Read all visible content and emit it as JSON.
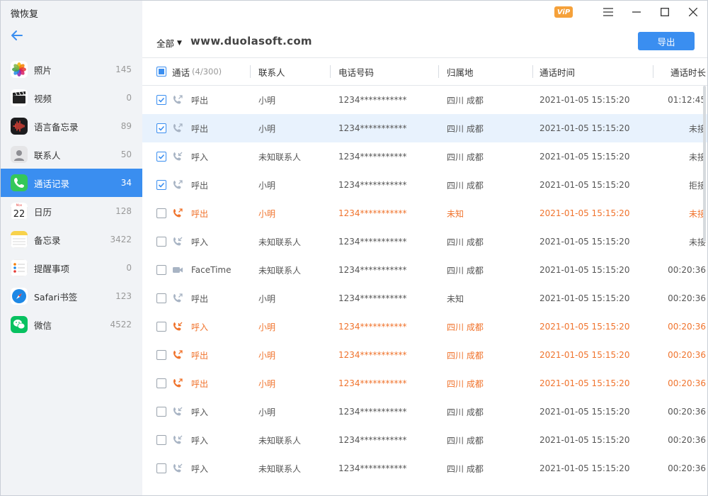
{
  "app": {
    "title": "微恢复",
    "vip_label": "ViP"
  },
  "sidebar": {
    "items": [
      {
        "label": "照片",
        "count": "145",
        "icon": "photos-icon"
      },
      {
        "label": "视频",
        "count": "0",
        "icon": "video-icon"
      },
      {
        "label": "语言备忘录",
        "count": "89",
        "icon": "voice-memo-icon"
      },
      {
        "label": "联系人",
        "count": "50",
        "icon": "contacts-icon"
      },
      {
        "label": "通话记录",
        "count": "34",
        "icon": "phone-icon",
        "active": true
      },
      {
        "label": "日历",
        "count": "128",
        "icon": "calendar-icon",
        "calendar_day": "22"
      },
      {
        "label": "备忘录",
        "count": "3422",
        "icon": "notes-icon"
      },
      {
        "label": "提醒事项",
        "count": "0",
        "icon": "reminders-icon"
      },
      {
        "label": "Safari书签",
        "count": "123",
        "icon": "safari-icon"
      },
      {
        "label": "微信",
        "count": "4522",
        "icon": "wechat-icon"
      }
    ]
  },
  "toolbar": {
    "filter_label": "全部",
    "watermark": "www.duolasoft.com",
    "export_label": "导出"
  },
  "table": {
    "headers": {
      "type": "通话",
      "type_count": "(4/300)",
      "contact": "联系人",
      "phone": "电话号码",
      "location": "归属地",
      "time": "通话时间",
      "duration": "通话时长"
    },
    "rows": [
      {
        "checked": true,
        "kind": "out",
        "type": "呼出",
        "contact": "小明",
        "phone": "1234***********",
        "location": "四川 成都",
        "time": "2021-01-05 15:15:20",
        "duration": "01:12:45",
        "missed": false,
        "selected": false
      },
      {
        "checked": true,
        "kind": "out",
        "type": "呼出",
        "contact": "小明",
        "phone": "1234***********",
        "location": "四川 成都",
        "time": "2021-01-05 15:15:20",
        "duration": "未接",
        "missed": false,
        "selected": true
      },
      {
        "checked": true,
        "kind": "in",
        "type": "呼入",
        "contact": "未知联系人",
        "phone": "1234***********",
        "location": "四川 成都",
        "time": "2021-01-05 15:15:20",
        "duration": "未接",
        "missed": false,
        "selected": false
      },
      {
        "checked": true,
        "kind": "out",
        "type": "呼出",
        "contact": "小明",
        "phone": "1234***********",
        "location": "四川 成都",
        "time": "2021-01-05 15:15:20",
        "duration": "拒接",
        "missed": false,
        "selected": false
      },
      {
        "checked": false,
        "kind": "out",
        "type": "呼出",
        "contact": "小明",
        "phone": "1234***********",
        "location": "未知",
        "time": "2021-01-05 15:15:20",
        "duration": "未接",
        "missed": true,
        "selected": false
      },
      {
        "checked": false,
        "kind": "in",
        "type": "呼入",
        "contact": "未知联系人",
        "phone": "1234***********",
        "location": "四川 成都",
        "time": "2021-01-05 15:15:20",
        "duration": "未接",
        "missed": false,
        "selected": false
      },
      {
        "checked": false,
        "kind": "facetime",
        "type": "FaceTime",
        "contact": "未知联系人",
        "phone": "1234***********",
        "location": "四川 成都",
        "time": "2021-01-05 15:15:20",
        "duration": "00:20:36",
        "missed": false,
        "selected": false
      },
      {
        "checked": false,
        "kind": "out",
        "type": "呼出",
        "contact": "小明",
        "phone": "1234***********",
        "location": "未知",
        "time": "2021-01-05 15:15:20",
        "duration": "00:20:36",
        "missed": false,
        "selected": false
      },
      {
        "checked": false,
        "kind": "in",
        "type": "呼入",
        "contact": "小明",
        "phone": "1234***********",
        "location": "四川 成都",
        "time": "2021-01-05 15:15:20",
        "duration": "00:20:36",
        "missed": true,
        "selected": false
      },
      {
        "checked": false,
        "kind": "out",
        "type": "呼出",
        "contact": "小明",
        "phone": "1234***********",
        "location": "四川 成都",
        "time": "2021-01-05 15:15:20",
        "duration": "00:20:36",
        "missed": true,
        "selected": false
      },
      {
        "checked": false,
        "kind": "out",
        "type": "呼出",
        "contact": "小明",
        "phone": "1234***********",
        "location": "四川 成都",
        "time": "2021-01-05 15:15:20",
        "duration": "00:20:36",
        "missed": true,
        "selected": false
      },
      {
        "checked": false,
        "kind": "in",
        "type": "呼入",
        "contact": "小明",
        "phone": "1234***********",
        "location": "四川 成都",
        "time": "2021-01-05 15:15:20",
        "duration": "00:20:36",
        "missed": false,
        "selected": false
      },
      {
        "checked": false,
        "kind": "in",
        "type": "呼入",
        "contact": "未知联系人",
        "phone": "1234***********",
        "location": "四川 成都",
        "time": "2021-01-05 15:15:20",
        "duration": "00:20:36",
        "missed": false,
        "selected": false
      },
      {
        "checked": false,
        "kind": "in",
        "type": "呼入",
        "contact": "未知联系人",
        "phone": "1234***********",
        "location": "四川 成都",
        "time": "2021-01-05 15:15:20",
        "duration": "00:20:36",
        "missed": false,
        "selected": false
      }
    ]
  },
  "colors": {
    "accent": "#3a8ef0",
    "missed": "#f0732c",
    "selected_row": "#e8f2fd",
    "sidebar_bg": "#f1f3f6"
  }
}
